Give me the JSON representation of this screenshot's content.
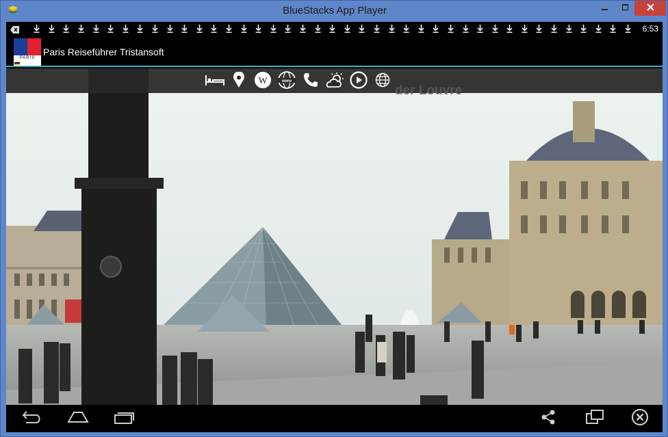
{
  "window": {
    "title": "BlueStacks App Player",
    "icon": "bluestacks-logo-icon",
    "controls": [
      "minimize-icon",
      "maximize-icon",
      "close-icon"
    ]
  },
  "statusbar": {
    "time": "6:53",
    "notification_count": 41,
    "notification_icon": "download-icon"
  },
  "app": {
    "title": "Paris Reiseführer Tristansoft",
    "logo_label": "PARIS"
  },
  "toolbar": {
    "icons": [
      "bed-icon",
      "map-pin-icon",
      "wikipedia-icon",
      "www-icon",
      "phone-icon",
      "weather-icon",
      "play-icon",
      "globe-icon"
    ],
    "place_name": "der Louvre"
  },
  "navbar": {
    "left": [
      "back-icon",
      "home-icon",
      "recents-icon"
    ],
    "right": [
      "share-icon",
      "rotate-icon",
      "close-app-icon"
    ]
  },
  "colors": {
    "window_frame": "#5f86c9",
    "close_button": "#c7413d",
    "accent_line": "#35b0d4"
  }
}
